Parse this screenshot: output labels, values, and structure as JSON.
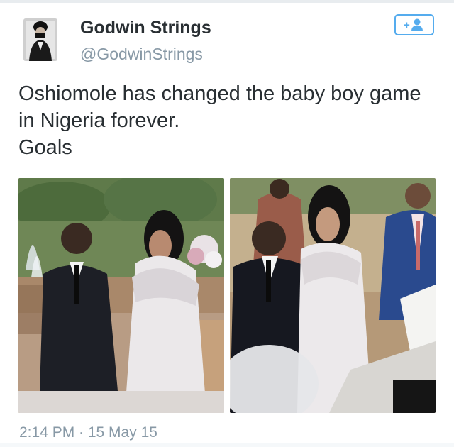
{
  "tweet": {
    "author": {
      "name": "Godwin Strings",
      "handle": "@GodwinStrings",
      "avatar_icon": "profile-photo-icon"
    },
    "follow_button": {
      "icon": "add-user-icon",
      "label": "+"
    },
    "text_lines": [
      "Oshiomole has changed the baby boy game",
      "in Nigeria forever.",
      "Goals"
    ],
    "timestamp": "2:14 PM · 15 May 15",
    "colors": {
      "accent": "#55acee",
      "secondary_text": "#8899a6",
      "primary_text": "#292f33"
    }
  }
}
